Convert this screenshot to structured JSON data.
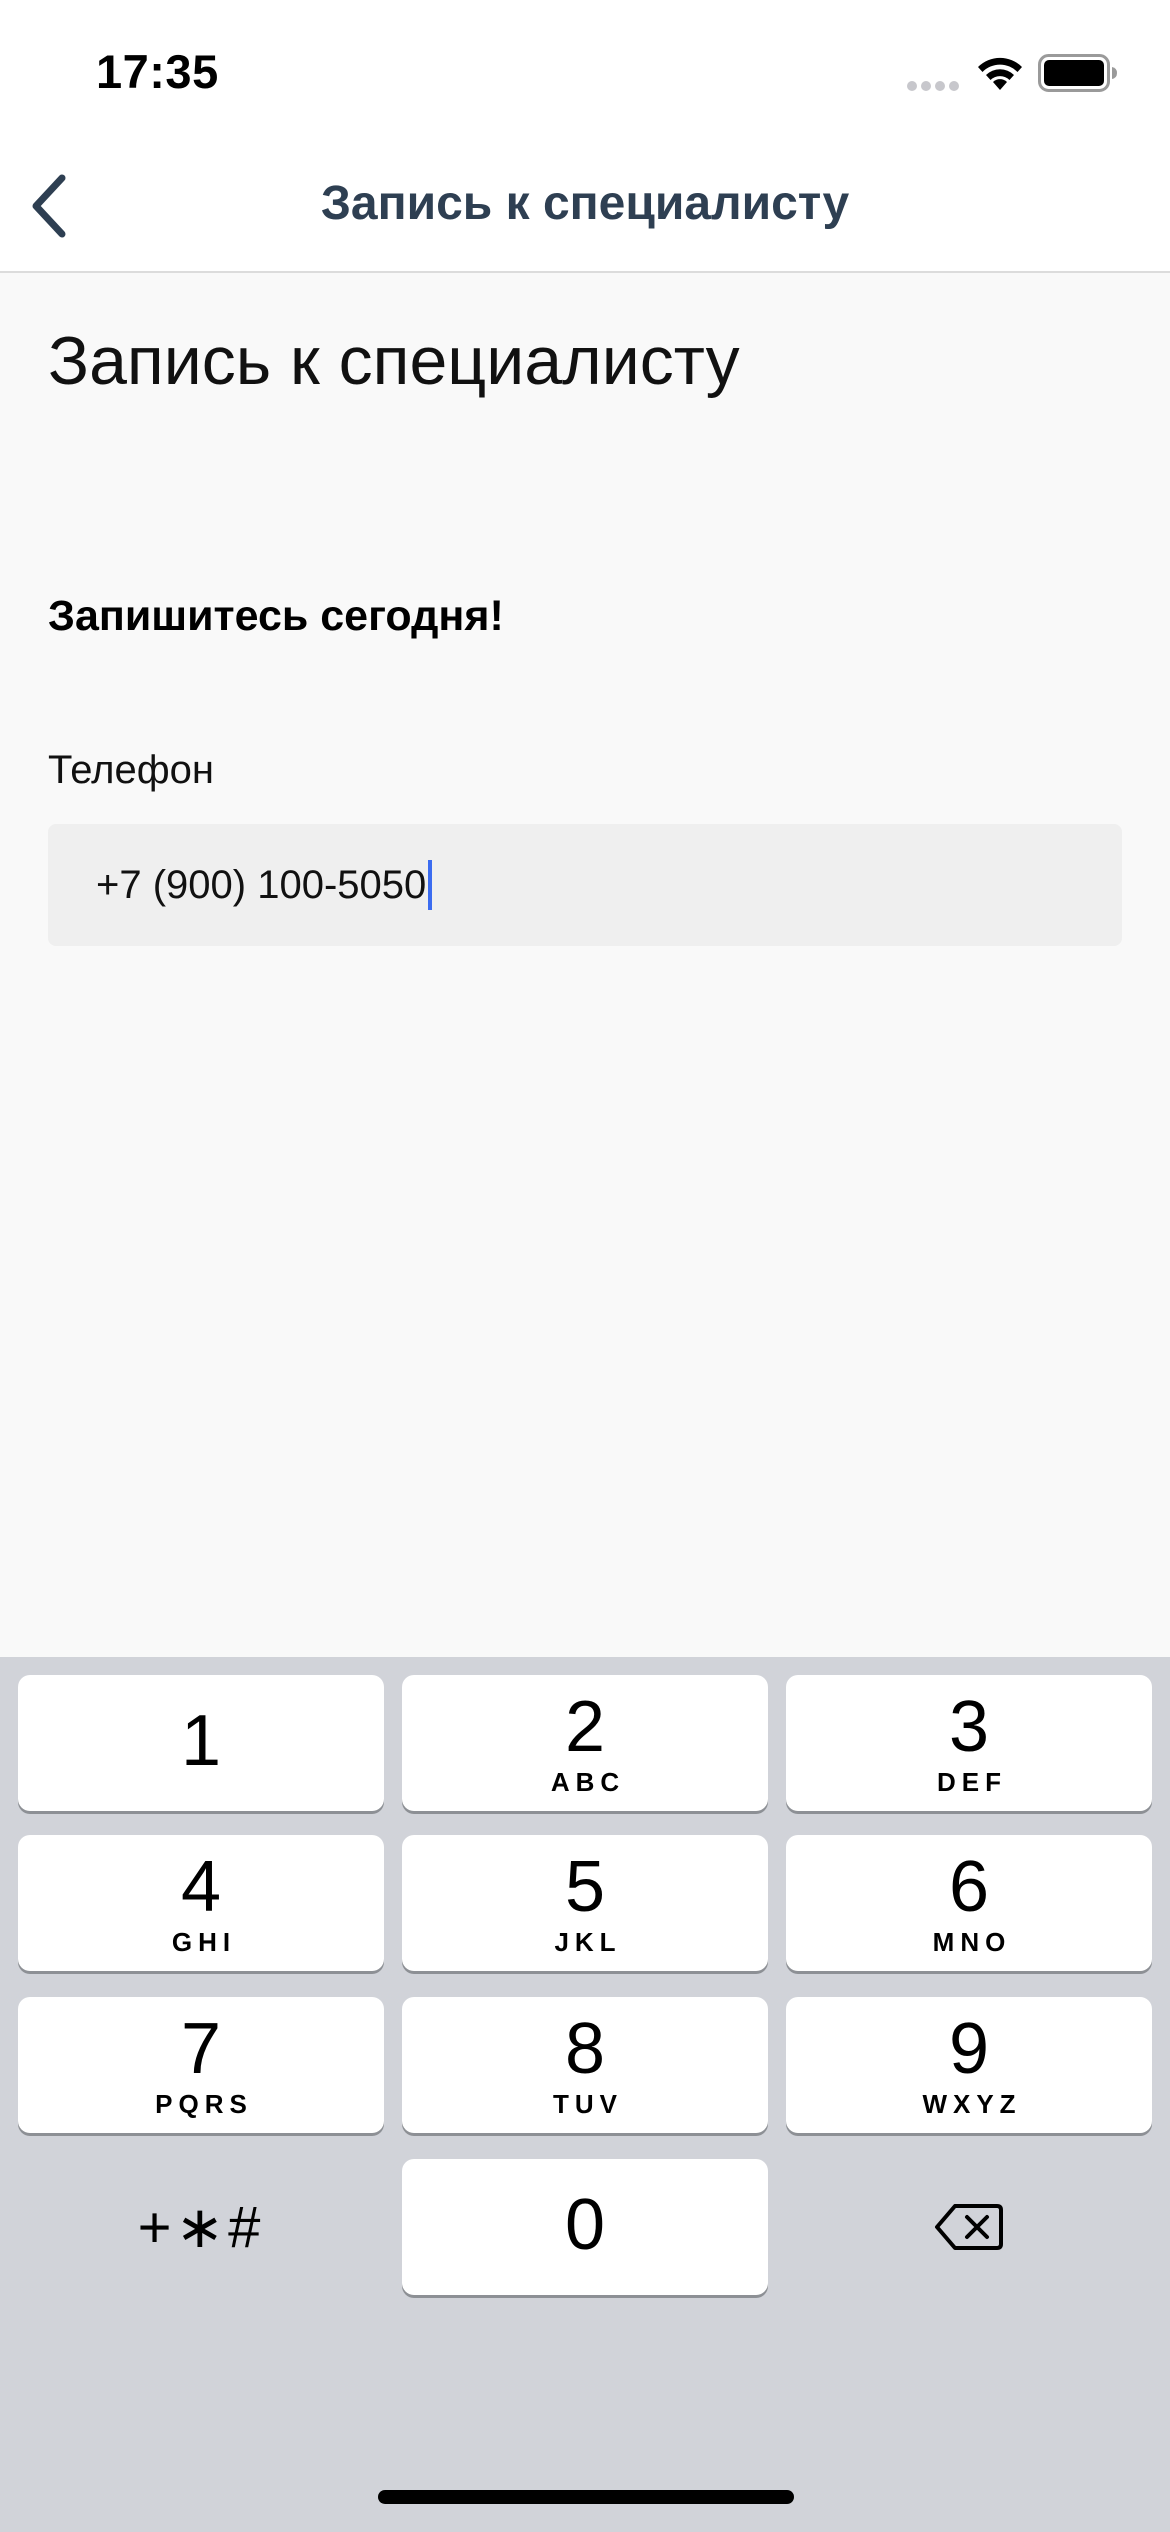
{
  "status_bar": {
    "time": "17:35",
    "icons": [
      "signal-dots-icon",
      "wifi-icon",
      "battery-icon"
    ]
  },
  "nav": {
    "back_icon": "chevron-left-icon",
    "title": "Запись к специалисту"
  },
  "content": {
    "page_title": "Запись к специалисту",
    "promo": "Запишитесь сегодня!",
    "phone_label": "Телефон",
    "phone_value": "+7 (900) 100-5050"
  },
  "keypad": {
    "keys": [
      {
        "digit": "1",
        "letters": ""
      },
      {
        "digit": "2",
        "letters": "ABC"
      },
      {
        "digit": "3",
        "letters": "DEF"
      },
      {
        "digit": "4",
        "letters": "GHI"
      },
      {
        "digit": "5",
        "letters": "JKL"
      },
      {
        "digit": "6",
        "letters": "MNO"
      },
      {
        "digit": "7",
        "letters": "PQRS"
      },
      {
        "digit": "8",
        "letters": "TUV"
      },
      {
        "digit": "9",
        "letters": "WXYZ"
      },
      {
        "digit": "0",
        "letters": ""
      }
    ],
    "symbols": "+∗#",
    "delete_icon": "backspace-icon"
  },
  "colors": {
    "nav_title": "#2e3f52",
    "caret": "#3b6cf0",
    "keypad_bg": "#d1d3d9",
    "field_bg": "#efefef"
  }
}
